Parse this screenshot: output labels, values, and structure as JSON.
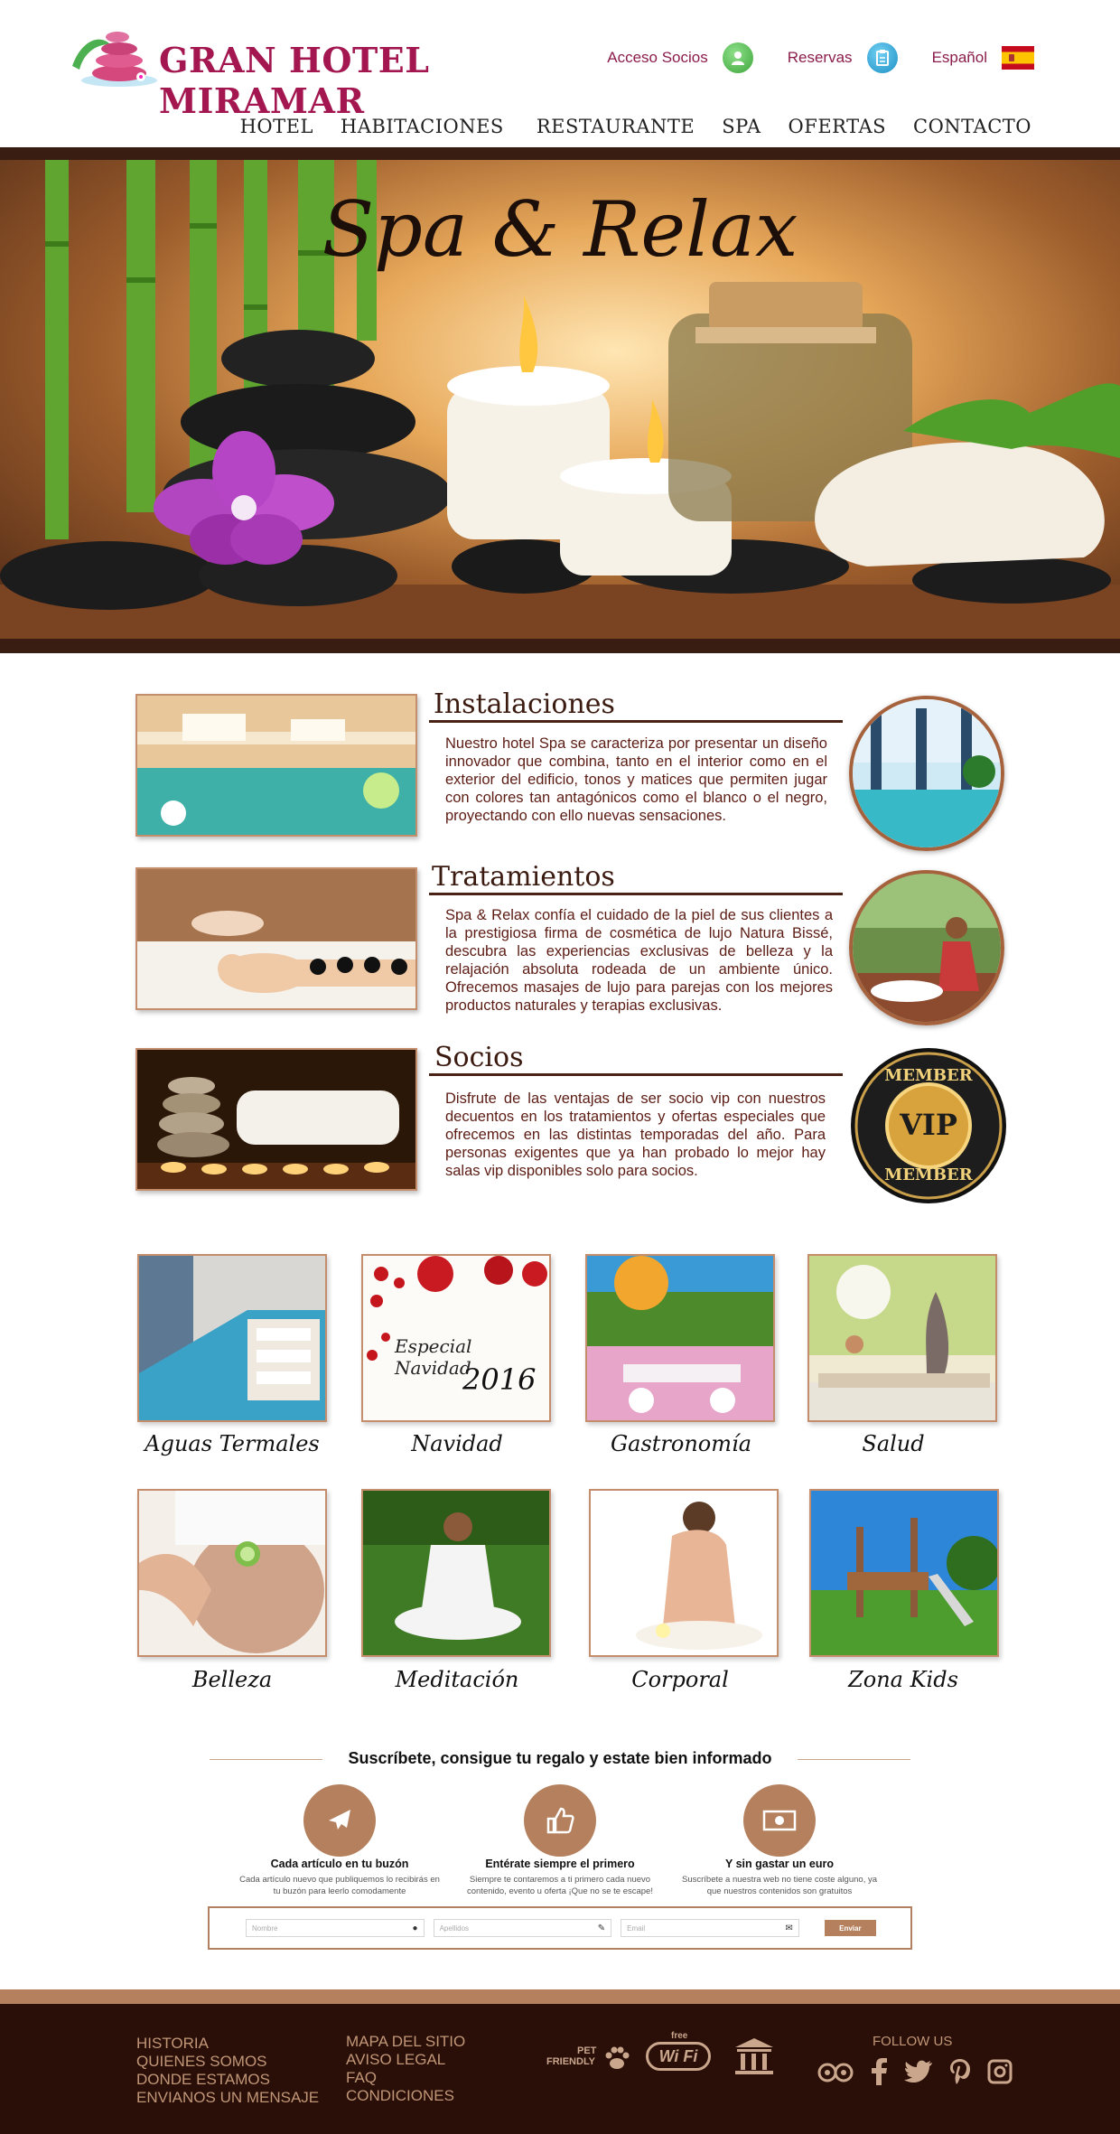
{
  "header": {
    "logo_text": "GRAN HOTEL MIRAMAR",
    "links": [
      {
        "label": "Acceso Socios",
        "icon": "user-icon"
      },
      {
        "label": "Reservas",
        "icon": "clipboard-icon"
      },
      {
        "label": "Español",
        "icon": "spain-flag-icon"
      }
    ]
  },
  "nav": [
    "HOTEL",
    "HABITACIONES",
    "RESTAURANTE",
    "SPA",
    "OFERTAS",
    "CONTACTO"
  ],
  "hero": {
    "title": "Spa & Relax"
  },
  "features": [
    {
      "title": "Instalaciones",
      "text": "Nuestro hotel Spa se caracteriza por presentar un diseño innovador que combina, tanto en el interior como en el exterior del edificio, tonos y matices que permiten jugar con colores tan antagónicos como el blanco o el negro, proyectando con ello nuevas sensaciones."
    },
    {
      "title": "Tratamientos",
      "text": "Spa & Relax confía el cuidado de la piel de sus clientes a la prestigiosa firma de cosmética de lujo Natura Bissé, descubra las experiencias exclusivas de belleza y la relajación absoluta rodeada de un ambiente único. Ofrecemos masajes de lujo para parejas con los mejores productos naturales y terapias exclusivas."
    },
    {
      "title": "Socios",
      "text": "Disfrute de las ventajas de ser socio vip con nuestros decuentos en los tratamientos y ofertas especiales que ofrecemos en las distintas temporadas del año. Para personas exigentes que ya han probado lo mejor hay salas vip disponibles solo para socios.",
      "badge": {
        "top": "MEMBER",
        "center": "VIP",
        "bottom": "MEMBER"
      }
    }
  ],
  "gallery": [
    {
      "caption": "Aguas Termales"
    },
    {
      "caption": "Navidad",
      "overlay_line1": "Especial Navidad",
      "overlay_line2": "2016"
    },
    {
      "caption": "Gastronomía"
    },
    {
      "caption": "Salud"
    },
    {
      "caption": "Belleza"
    },
    {
      "caption": "Meditación"
    },
    {
      "caption": "Corporal"
    },
    {
      "caption": "Zona Kids"
    }
  ],
  "subscribe": {
    "title": "Suscríbete, consigue tu regalo y estate bien informado",
    "items": [
      {
        "icon": "plane-icon",
        "head": "Cada artículo en tu buzón",
        "desc": "Cada artículo nuevo que publiquemos lo recibirás en tu buzón para leerlo comodamente"
      },
      {
        "icon": "thumbs-up-icon",
        "head": "Entérate siempre el primero",
        "desc": "Siempre te contaremos a ti primero cada nuevo contenido, evento u oferta ¡Que no se te escape!"
      },
      {
        "icon": "money-icon",
        "head": "Y sin gastar un euro",
        "desc": "Suscríbete a nuestra web no tiene coste alguno, ya que nuestros contenidos son gratuitos"
      }
    ],
    "form": {
      "name_placeholder": "Nombre",
      "surname_placeholder": "Apellidos",
      "email_placeholder": "Email",
      "submit_label": "Enviar"
    }
  },
  "footer": {
    "col1": [
      "HISTORIA",
      "QUIENES SOMOS",
      "DONDE ESTAMOS",
      "ENVIANOS UN MENSAJE"
    ],
    "col2": [
      "MAPA DEL SITIO",
      "AVISO LEGAL",
      "FAQ",
      "CONDICIONES"
    ],
    "badges": {
      "pet_line1": "PET",
      "pet_line2": "FRIENDLY",
      "wifi_top": "free",
      "wifi": "Wi Fi"
    },
    "follow_label": "FOLLOW US",
    "social": [
      "tripadvisor-icon",
      "facebook-icon",
      "twitter-icon",
      "pinterest-icon",
      "instagram-icon"
    ]
  },
  "colors": {
    "brand": "#a3164f",
    "accent": "#b4805d",
    "footer_bg": "#2a0f08"
  }
}
